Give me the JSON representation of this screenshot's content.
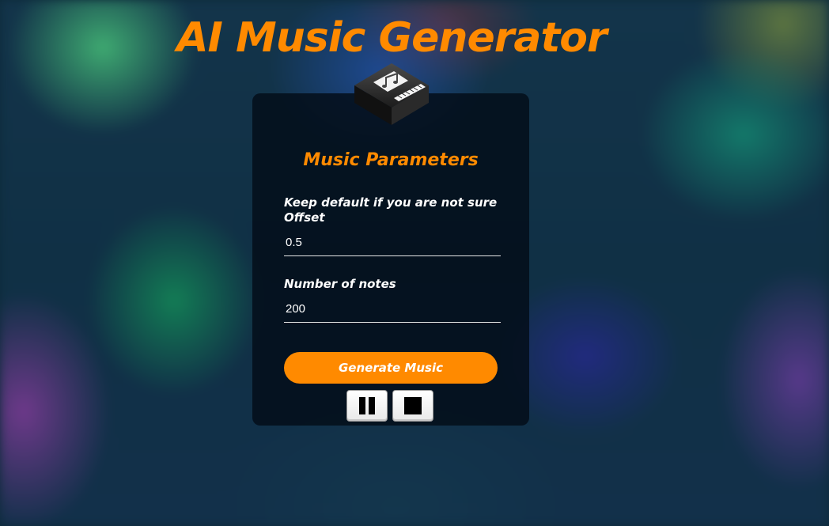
{
  "app": {
    "title": "AI Music Generator"
  },
  "card": {
    "heading": "Music Parameters",
    "logo_icon": "piano-music-icon"
  },
  "fields": {
    "offset": {
      "hint": "Keep default if you are not sure",
      "label": "Offset",
      "value": "0.5"
    },
    "notes": {
      "label": "Number of notes",
      "value": "200"
    }
  },
  "actions": {
    "generate_label": "Generate Music",
    "pause_icon": "pause-icon",
    "stop_icon": "stop-icon"
  },
  "colors": {
    "accent": "#ff8a00",
    "card_bg": "#040e1a",
    "text": "#ffffff"
  }
}
